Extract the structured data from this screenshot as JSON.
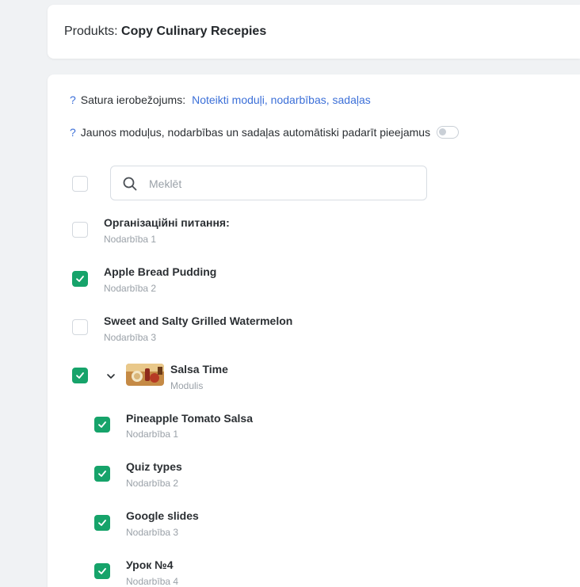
{
  "header": {
    "product_label": "Produkts:",
    "product_name": "Copy Culinary Recepies"
  },
  "restrictions": {
    "question_mark": "?",
    "label": "Satura ierobežojums:",
    "link": "Noteikti moduļi, nodarbības, sadaļas"
  },
  "auto_access": {
    "question_mark": "?",
    "label": "Jaunos moduļus, nodarbības un sadaļas automātiski padarīt pieejamus",
    "enabled": false
  },
  "search": {
    "placeholder": "Meklēt",
    "value": ""
  },
  "items": [
    {
      "title": "Організаційні питання:",
      "subtitle": "Nodarbība 1",
      "checked": false
    },
    {
      "title": "Apple Bread Pudding",
      "subtitle": "Nodarbība 2",
      "checked": true
    },
    {
      "title": "Sweet and Salty Grilled Watermelon",
      "subtitle": "Nodarbība 3",
      "checked": false
    },
    {
      "title": "Salsa Time",
      "subtitle": "Modulis",
      "checked": true,
      "expanded": true,
      "has_thumbnail": true
    }
  ],
  "sub_items": [
    {
      "title": "Pineapple Tomato Salsa",
      "subtitle": "Nodarbība 1",
      "checked": true
    },
    {
      "title": "Quiz types",
      "subtitle": "Nodarbība 2",
      "checked": true
    },
    {
      "title": "Google slides",
      "subtitle": "Nodarbība 3",
      "checked": true
    },
    {
      "title": "Урок №4",
      "subtitle": "Nodarbība 4",
      "checked": true
    }
  ],
  "colors": {
    "accent_link": "#3b6fd8",
    "checked_green": "#16a36a",
    "background": "#f0f2f4"
  }
}
